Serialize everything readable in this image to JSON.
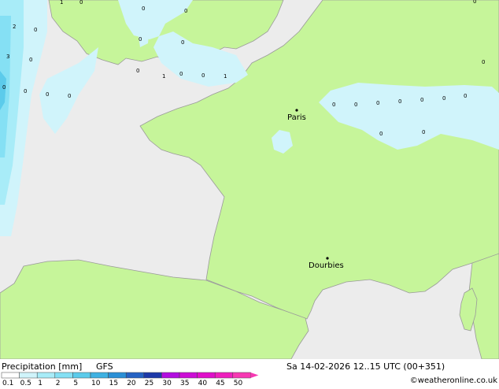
{
  "map": {
    "cities": [
      {
        "name": "Paris"
      },
      {
        "name": "Dourbies"
      }
    ],
    "station_values": [
      "1",
      "0",
      "0",
      "0",
      "0",
      "2",
      "0",
      "3",
      "0",
      "0",
      "0",
      "0",
      "1",
      "1",
      "0",
      "0",
      "0",
      "0",
      "0",
      "0",
      "0",
      "0",
      "0",
      "0",
      "0",
      "0",
      "0",
      "0",
      "0",
      "0"
    ]
  },
  "legend": {
    "title": "Precipitation [mm]",
    "model": "GFS",
    "ticks": [
      "0.1",
      "0.5",
      "1",
      "2",
      "5",
      "10",
      "15",
      "20",
      "25",
      "30",
      "35",
      "40",
      "45",
      "50"
    ],
    "colors": [
      "#ffffff",
      "#d0f4fb",
      "#a8ecf8",
      "#85e0f4",
      "#5ccbeb",
      "#3fb1e2",
      "#2a8fd6",
      "#2562c3",
      "#1d39a8",
      "#b20de0",
      "#cc0ed6",
      "#e00fca",
      "#ee1fbd",
      "#f739b3"
    ]
  },
  "timestamp": "Sa 14-02-2026 12..15 UTC (00+351)",
  "credit": "©weatheronline.co.uk"
}
